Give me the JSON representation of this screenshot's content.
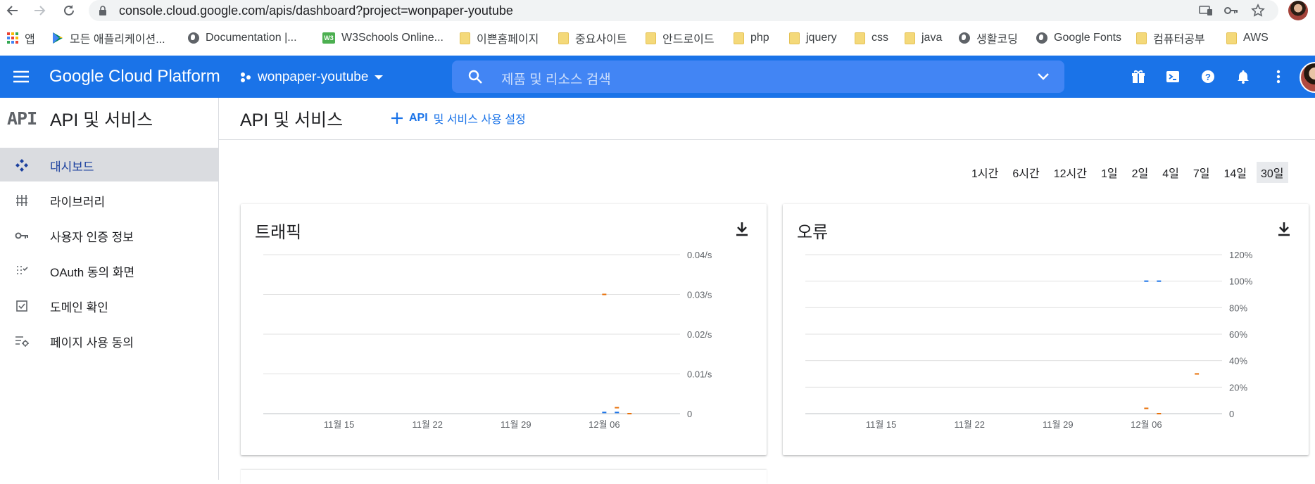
{
  "browser": {
    "url": "console.cloud.google.com/apis/dashboard?project=wonpaper-youtube",
    "bookmarks": [
      {
        "label": "앱",
        "icon": "apps-grid-icon"
      },
      {
        "label": "모든 애플리케이션...",
        "icon": "play-store-icon"
      },
      {
        "label": "Documentation   |...",
        "icon": "globe-icon"
      },
      {
        "label": "W3Schools Online...",
        "icon": "w3schools-icon"
      },
      {
        "label": "이쁜홈페이지",
        "icon": "folder-icon"
      },
      {
        "label": "중요사이트",
        "icon": "folder-icon"
      },
      {
        "label": "안드로이드",
        "icon": "folder-icon"
      },
      {
        "label": "php",
        "icon": "folder-icon"
      },
      {
        "label": "jquery",
        "icon": "folder-icon"
      },
      {
        "label": "css",
        "icon": "folder-icon"
      },
      {
        "label": "java",
        "icon": "folder-icon"
      },
      {
        "label": "생활코딩",
        "icon": "globe-icon"
      },
      {
        "label": "Google Fonts",
        "icon": "globe-icon"
      },
      {
        "label": "컴퓨터공부",
        "icon": "folder-icon"
      },
      {
        "label": "AWS",
        "icon": "folder-icon"
      }
    ]
  },
  "header": {
    "brand": "Google Cloud Platform",
    "project": "wonpaper-youtube",
    "search_placeholder": "제품 및 리소스 검색",
    "accent": "#1a73e8"
  },
  "sidebar": {
    "logo": "API",
    "title": "API 및 서비스",
    "items": [
      {
        "label": "대시보드",
        "icon": "dashboard-icon",
        "active": true
      },
      {
        "label": "라이브러리",
        "icon": "library-icon",
        "active": false
      },
      {
        "label": "사용자 인증 정보",
        "icon": "key-icon",
        "active": false
      },
      {
        "label": "OAuth 동의 화면",
        "icon": "consent-icon",
        "active": false
      },
      {
        "label": "도메인 확인",
        "icon": "checkbox-icon",
        "active": false
      },
      {
        "label": "페이지 사용 동의",
        "icon": "settings-list-icon",
        "active": false
      }
    ]
  },
  "main": {
    "title": "API 및 서비스",
    "enable_button_bold": "API",
    "enable_button_rest": "및 서비스 사용 설정",
    "time_ranges": [
      "1시간",
      "6시간",
      "12시간",
      "1일",
      "2일",
      "4일",
      "7일",
      "14일",
      "30일"
    ],
    "selected_range": "30일"
  },
  "chart_data": [
    {
      "type": "line",
      "title": "트래픽",
      "x_ticks": [
        "11월 15",
        "11월 22",
        "11월 29",
        "12월 06"
      ],
      "y_ticks": [
        "0",
        "0.01/s",
        "0.02/s",
        "0.03/s",
        "0.04/s"
      ],
      "ylim": [
        0,
        0.04
      ],
      "y_axis_position": "right",
      "grid": true,
      "series": [
        {
          "color": "#e8710a",
          "points": [
            [
              "12월 06",
              0.03
            ],
            [
              "12월 07",
              0.0015
            ],
            [
              "12월 08",
              0
            ]
          ]
        },
        {
          "color": "#1a73e8",
          "points": [
            [
              "12월 06",
              0.0003
            ],
            [
              "12월 07",
              0.0003
            ]
          ]
        }
      ]
    },
    {
      "type": "line",
      "title": "오류",
      "x_ticks": [
        "11월 15",
        "11월 22",
        "11월 29",
        "12월 06"
      ],
      "y_ticks": [
        "0",
        "20%",
        "40%",
        "60%",
        "80%",
        "100%",
        "120%"
      ],
      "ylim": [
        0,
        120
      ],
      "y_axis_position": "right",
      "grid": true,
      "series": [
        {
          "color": "#1a73e8",
          "points": [
            [
              "12월 06",
              100
            ],
            [
              "12월 07",
              100
            ]
          ]
        },
        {
          "color": "#e8710a",
          "points": [
            [
              "12월 06",
              4
            ],
            [
              "12월 07",
              0
            ],
            [
              "12월 10",
              30
            ]
          ]
        }
      ]
    }
  ]
}
